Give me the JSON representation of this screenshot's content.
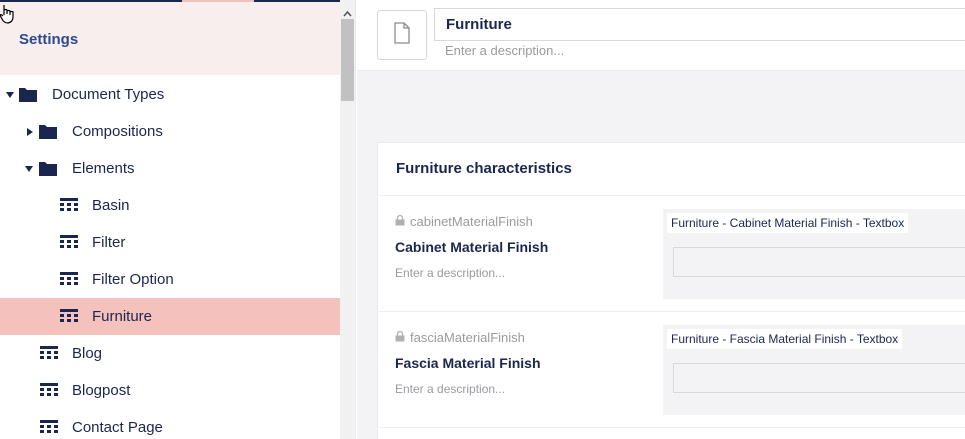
{
  "sidebar": {
    "title": "Settings",
    "tree": [
      {
        "label": "Document Types",
        "type": "folder",
        "expanded": true
      },
      {
        "label": "Compositions",
        "type": "folder",
        "expanded": false
      },
      {
        "label": "Elements",
        "type": "folder",
        "expanded": true
      },
      {
        "label": "Basin",
        "type": "doctype"
      },
      {
        "label": "Filter",
        "type": "doctype"
      },
      {
        "label": "Filter Option",
        "type": "doctype"
      },
      {
        "label": "Furniture",
        "type": "doctype",
        "selected": true
      },
      {
        "label": "Blog",
        "type": "doctype"
      },
      {
        "label": "Blogpost",
        "type": "doctype"
      },
      {
        "label": "Contact Page",
        "type": "doctype"
      }
    ]
  },
  "editor": {
    "name_value": "Furniture",
    "description_placeholder": "Enter a description...",
    "icon": "document-icon",
    "group": {
      "title": "Furniture characteristics",
      "properties": [
        {
          "alias": "cabinetMaterialFinish",
          "name": "Cabinet Material Finish",
          "description_placeholder": "Enter a description...",
          "editor_label": "Furniture - Cabinet Material Finish - Textbox"
        },
        {
          "alias": "fasciaMaterialFinish",
          "name": "Fascia Material Finish",
          "description_placeholder": "Enter a description...",
          "editor_label": "Furniture - Fascia Material Finish - Textbox"
        }
      ]
    }
  },
  "colors": {
    "navy": "#1b264f",
    "selected_bg": "#f5c1bc",
    "header_bg": "#f8eeee",
    "settings_title": "#2e4a8f"
  }
}
